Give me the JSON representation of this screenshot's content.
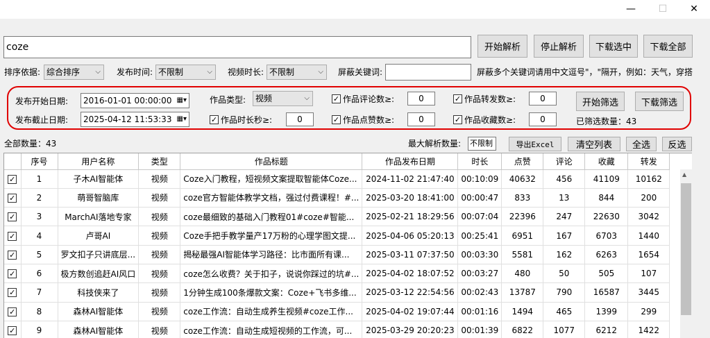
{
  "window": {
    "minimize": "—",
    "maximize": "☐",
    "close": "✕"
  },
  "search": {
    "value": "coze"
  },
  "buttons": {
    "start_parse": "开始解析",
    "stop_parse": "停止解析",
    "download_selected": "下载选中",
    "download_all": "下载全部",
    "start_filter": "开始筛选",
    "download_filter": "下载筛选",
    "export_excel": "导出Excel",
    "clear_list": "清空列表",
    "select_all": "全选",
    "invert": "反选"
  },
  "options": {
    "sort_label": "排序依据:",
    "sort_value": "综合排序",
    "time_label": "发布时间:",
    "time_value": "不限制",
    "duration_label": "视频时长:",
    "duration_value": "不限制",
    "block_label": "屏蔽关键词:",
    "block_value": "",
    "block_hint": "屏蔽多个关键词请用中文逗号\"，\"隔开，例如：天气，穿搭"
  },
  "filter": {
    "start_date_label": "发布开始日期:",
    "start_date": "2016-01-01 00:00:00",
    "end_date_label": "发布截止日期:",
    "end_date": "2025-04-12 11:53:33",
    "type_label": "作品类型:",
    "type_value": "视频",
    "duration_label": "作品时长秒≥:",
    "duration_value": "0",
    "comments_label": "作品评论数≥:",
    "comments_value": "0",
    "likes_label": "作品点赞数≥:",
    "likes_value": "0",
    "shares_label": "作品转发数≥:",
    "shares_value": "0",
    "favs_label": "作品收藏数≥:",
    "favs_value": "0",
    "filtered_count": "已筛选数量：43"
  },
  "list": {
    "total": "全部数量：43",
    "max_label": "最大解析数量:",
    "max_value": "不限制",
    "headers": [
      "",
      "序号",
      "用户名称",
      "类型",
      "作品标题",
      "作品发布日期",
      "时长",
      "点赞",
      "评论",
      "收藏",
      "转发"
    ],
    "rows": [
      [
        "☑",
        "1",
        "子木AI智能体",
        "视频",
        "Coze入门教程，短视频文案提取智能体Coze...",
        "2024-11-02 21:47:40",
        "00:10:09",
        "40632",
        "456",
        "41109",
        "10162"
      ],
      [
        "☑",
        "2",
        "萌哥智脑库",
        "视频",
        "coze官方智能体教学文档，强过付费课程！#...",
        "2025-03-20 18:41:00",
        "00:00:47",
        "833",
        "13",
        "844",
        "200"
      ],
      [
        "☑",
        "3",
        "MarchAI落地专家",
        "视频",
        "coze最细致的基础入门教程01#coze#智能...",
        "2025-02-21 18:29:56",
        "00:07:04",
        "22396",
        "247",
        "22630",
        "3042"
      ],
      [
        "☑",
        "4",
        "卢哥AI",
        "视频",
        "Coze手把手教学量产17万粉的心理学图文提...",
        "2025-04-06 05:20:13",
        "00:25:41",
        "6951",
        "167",
        "6703",
        "1440"
      ],
      [
        "☑",
        "5",
        "罗文扣子只讲底层...",
        "视频",
        "揭秘最强AI智能体学习路径：比市面所有课...",
        "2025-03-11 07:37:50",
        "00:03:30",
        "5581",
        "162",
        "6263",
        "1654"
      ],
      [
        "☑",
        "6",
        "极方数创追赶AI风口",
        "视频",
        "coze怎么收费？关于扣子，说说你踩过的坑#...",
        "2025-04-02 18:07:52",
        "00:03:27",
        "480",
        "50",
        "505",
        "107"
      ],
      [
        "☑",
        "7",
        "科技侠来了",
        "视频",
        "1分钟生成100条爆款文案：Coze+飞书多维...",
        "2025-03-12 22:54:56",
        "00:02:43",
        "13787",
        "790",
        "16587",
        "3445"
      ],
      [
        "☑",
        "8",
        "森林AI智能体",
        "视频",
        "coze工作流：自动生成养生视频#coze工作...",
        "2025-04-02 19:07:44",
        "00:01:16",
        "1494",
        "465",
        "1399",
        "299"
      ],
      [
        "☑",
        "9",
        "森林AI智能体",
        "视频",
        "coze工作流：自动生成短视频的工作流，可...",
        "2025-03-29 20:20:23",
        "00:01:39",
        "6822",
        "1077",
        "6212",
        "1422"
      ]
    ]
  }
}
